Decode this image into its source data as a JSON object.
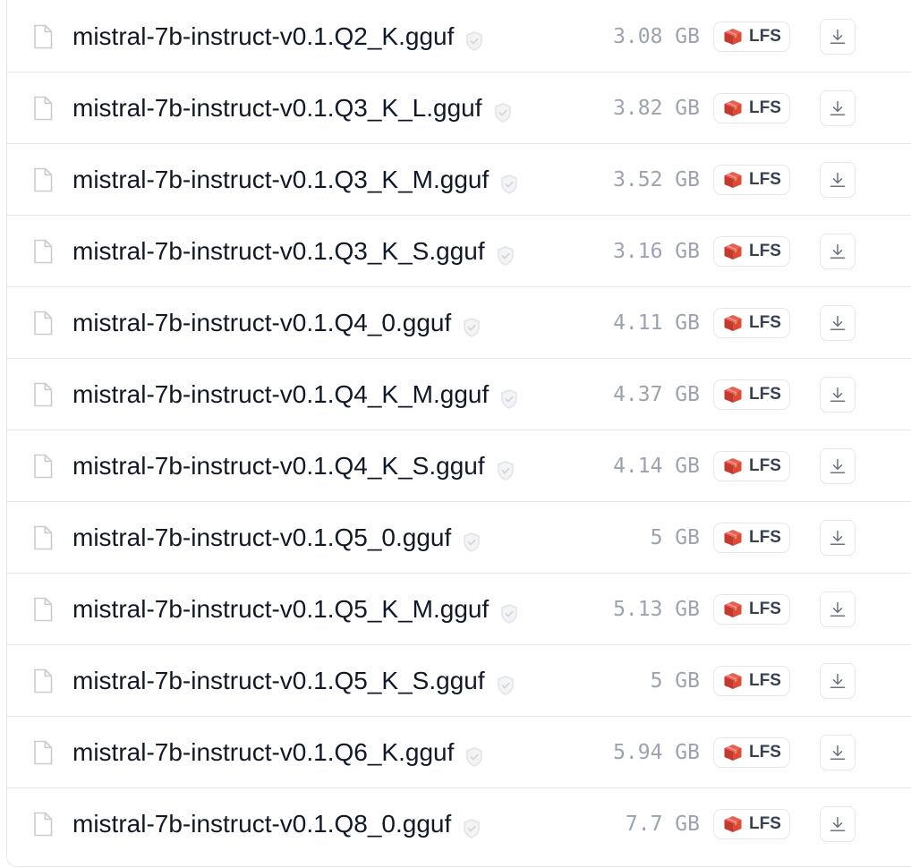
{
  "lfs_label": "LFS",
  "colors": {
    "filename": "#111827",
    "size": "#9ca3af",
    "border": "#e5e7eb",
    "lfs_icon": "#dc4a38"
  },
  "files": [
    {
      "name": "mistral-7b-instruct-v0.1.Q2_K.gguf",
      "size": "3.08 GB"
    },
    {
      "name": "mistral-7b-instruct-v0.1.Q3_K_L.gguf",
      "size": "3.82 GB"
    },
    {
      "name": "mistral-7b-instruct-v0.1.Q3_K_M.gguf",
      "size": "3.52 GB"
    },
    {
      "name": "mistral-7b-instruct-v0.1.Q3_K_S.gguf",
      "size": "3.16 GB"
    },
    {
      "name": "mistral-7b-instruct-v0.1.Q4_0.gguf",
      "size": "4.11 GB"
    },
    {
      "name": "mistral-7b-instruct-v0.1.Q4_K_M.gguf",
      "size": "4.37 GB"
    },
    {
      "name": "mistral-7b-instruct-v0.1.Q4_K_S.gguf",
      "size": "4.14 GB"
    },
    {
      "name": "mistral-7b-instruct-v0.1.Q5_0.gguf",
      "size": "5 GB"
    },
    {
      "name": "mistral-7b-instruct-v0.1.Q5_K_M.gguf",
      "size": "5.13 GB"
    },
    {
      "name": "mistral-7b-instruct-v0.1.Q5_K_S.gguf",
      "size": "5 GB"
    },
    {
      "name": "mistral-7b-instruct-v0.1.Q6_K.gguf",
      "size": "5.94 GB"
    },
    {
      "name": "mistral-7b-instruct-v0.1.Q8_0.gguf",
      "size": "7.7 GB"
    }
  ]
}
